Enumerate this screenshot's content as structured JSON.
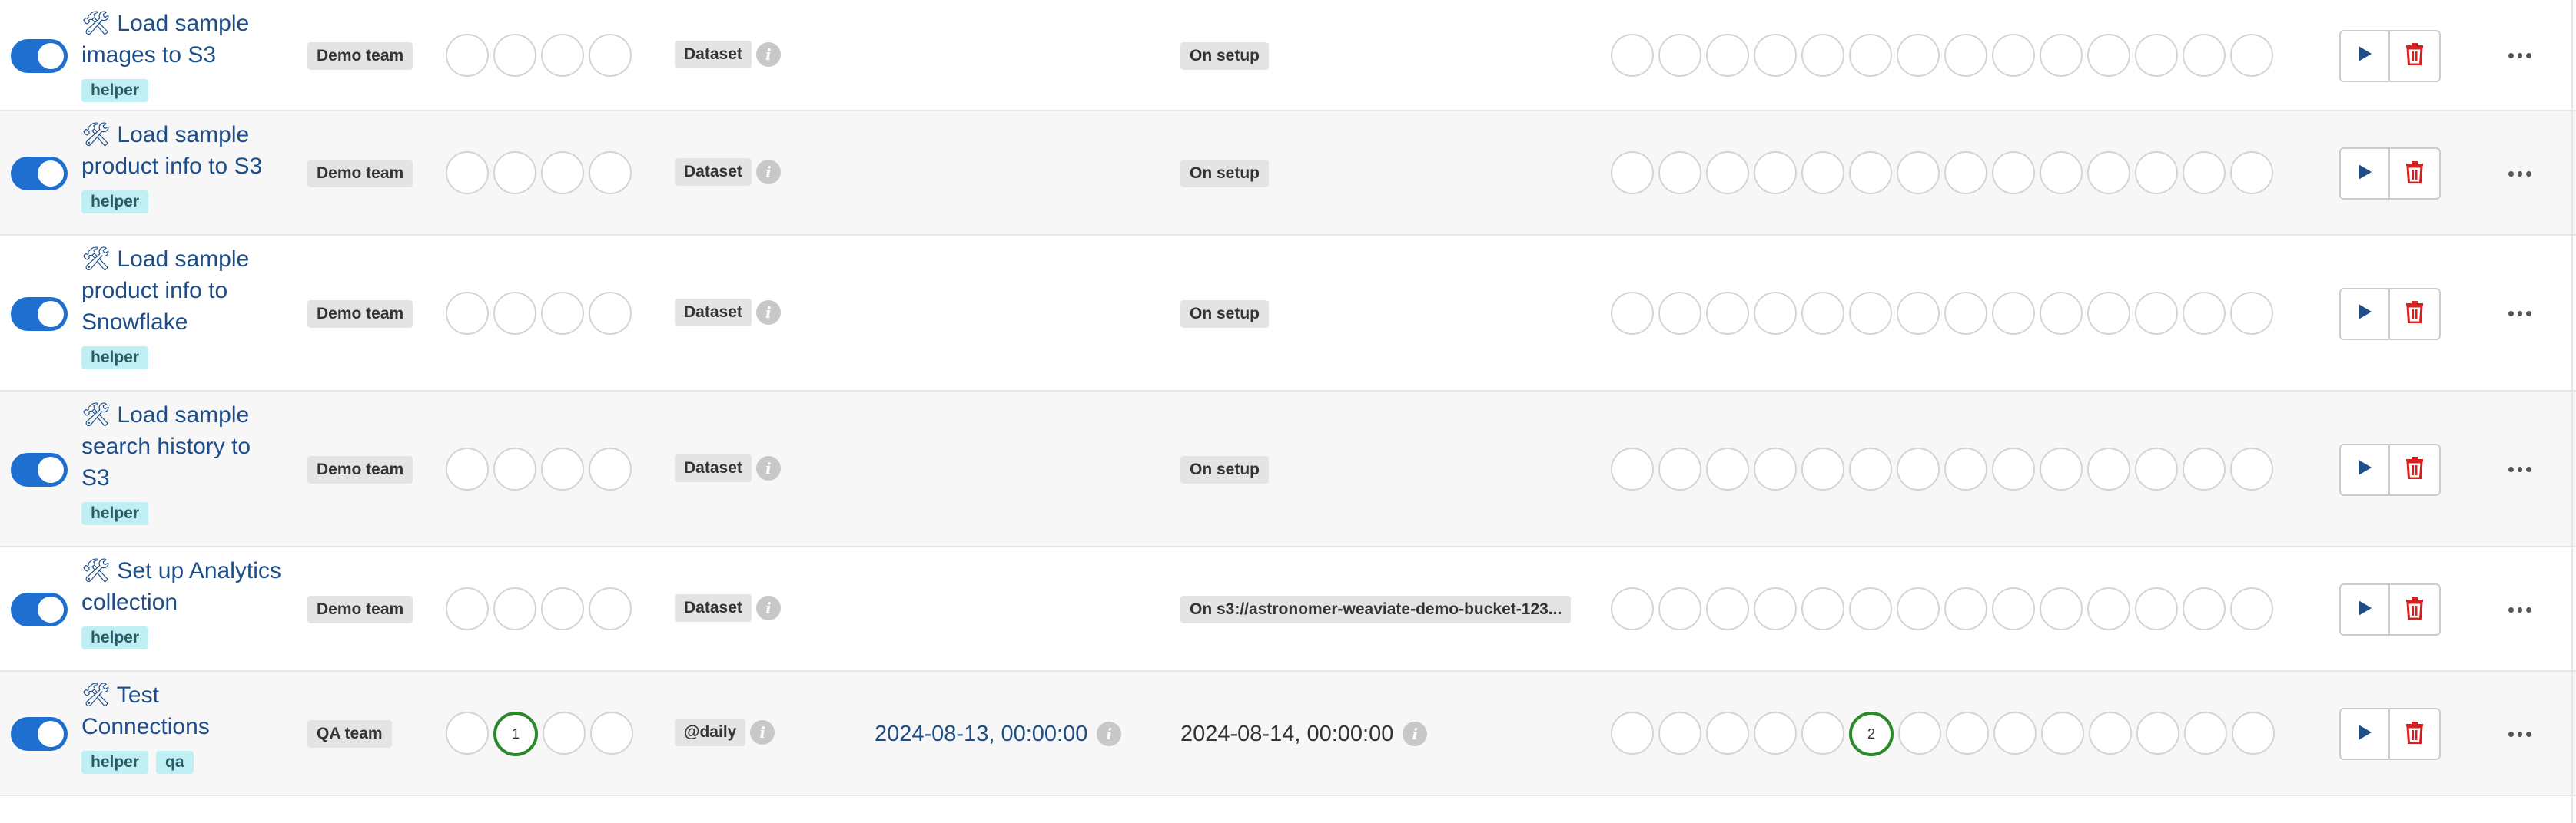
{
  "dags": [
    {
      "enabled": true,
      "icon": "hammer-wrench-icon",
      "name_lines": [
        "🛠 Load sample",
        "images to S3"
      ],
      "tags": [
        "helper"
      ],
      "owner": "Demo team",
      "runs": [
        "",
        "",
        "",
        ""
      ],
      "run_states": [
        "none",
        "none",
        "none",
        "none"
      ],
      "schedule": "Dataset",
      "last_run": "",
      "next_run_badge": "On setup",
      "next_run_text": "",
      "recent_tasks": [
        "",
        "",
        "",
        "",
        "",
        "",
        "",
        "",
        "",
        "",
        "",
        "",
        "",
        ""
      ],
      "recent_states": [
        "none",
        "none",
        "none",
        "none",
        "none",
        "none",
        "none",
        "none",
        "none",
        "none",
        "none",
        "none",
        "none",
        "none"
      ]
    },
    {
      "enabled": true,
      "icon": "hammer-wrench-icon",
      "name_lines": [
        "🛠 Load sample",
        "product info to S3"
      ],
      "tags": [
        "helper"
      ],
      "owner": "Demo team",
      "runs": [
        "",
        "",
        "",
        ""
      ],
      "run_states": [
        "none",
        "none",
        "none",
        "none"
      ],
      "schedule": "Dataset",
      "last_run": "",
      "next_run_badge": "On setup",
      "next_run_text": "",
      "recent_tasks": [
        "",
        "",
        "",
        "",
        "",
        "",
        "",
        "",
        "",
        "",
        "",
        "",
        "",
        ""
      ],
      "recent_states": [
        "none",
        "none",
        "none",
        "none",
        "none",
        "none",
        "none",
        "none",
        "none",
        "none",
        "none",
        "none",
        "none",
        "none"
      ]
    },
    {
      "enabled": true,
      "icon": "hammer-wrench-icon",
      "name_lines": [
        "🛠 Load sample",
        "product info to",
        "Snowflake"
      ],
      "tags": [
        "helper"
      ],
      "owner": "Demo team",
      "runs": [
        "",
        "",
        "",
        ""
      ],
      "run_states": [
        "none",
        "none",
        "none",
        "none"
      ],
      "schedule": "Dataset",
      "last_run": "",
      "next_run_badge": "On setup",
      "next_run_text": "",
      "recent_tasks": [
        "",
        "",
        "",
        "",
        "",
        "",
        "",
        "",
        "",
        "",
        "",
        "",
        "",
        ""
      ],
      "recent_states": [
        "none",
        "none",
        "none",
        "none",
        "none",
        "none",
        "none",
        "none",
        "none",
        "none",
        "none",
        "none",
        "none",
        "none"
      ]
    },
    {
      "enabled": true,
      "icon": "hammer-wrench-icon",
      "name_lines": [
        "🛠 Load sample",
        "search history to",
        "S3"
      ],
      "tags": [
        "helper"
      ],
      "owner": "Demo team",
      "runs": [
        "",
        "",
        "",
        ""
      ],
      "run_states": [
        "none",
        "none",
        "none",
        "none"
      ],
      "schedule": "Dataset",
      "last_run": "",
      "next_run_badge": "On setup",
      "next_run_text": "",
      "recent_tasks": [
        "",
        "",
        "",
        "",
        "",
        "",
        "",
        "",
        "",
        "",
        "",
        "",
        "",
        ""
      ],
      "recent_states": [
        "none",
        "none",
        "none",
        "none",
        "none",
        "none",
        "none",
        "none",
        "none",
        "none",
        "none",
        "none",
        "none",
        "none"
      ]
    },
    {
      "enabled": true,
      "icon": "hammer-wrench-icon",
      "name_lines": [
        "🛠 Set up Analytics",
        "collection"
      ],
      "tags": [
        "helper"
      ],
      "owner": "Demo team",
      "runs": [
        "",
        "",
        "",
        ""
      ],
      "run_states": [
        "none",
        "none",
        "none",
        "none"
      ],
      "schedule": "Dataset",
      "last_run": "",
      "next_run_badge": "On s3://astronomer-weaviate-demo-bucket-123...",
      "next_run_text": "",
      "recent_tasks": [
        "",
        "",
        "",
        "",
        "",
        "",
        "",
        "",
        "",
        "",
        "",
        "",
        "",
        ""
      ],
      "recent_states": [
        "none",
        "none",
        "none",
        "none",
        "none",
        "none",
        "none",
        "none",
        "none",
        "none",
        "none",
        "none",
        "none",
        "none"
      ]
    },
    {
      "enabled": true,
      "icon": "hammer-wrench-icon",
      "name_lines": [
        "🛠 Test",
        "Connections"
      ],
      "tags": [
        "helper",
        "qa"
      ],
      "owner": "QA team",
      "runs": [
        "",
        "1",
        "",
        ""
      ],
      "run_states": [
        "none",
        "success",
        "none",
        "none"
      ],
      "schedule": "@daily",
      "last_run": "2024-08-13, 00:00:00",
      "next_run_badge": "",
      "next_run_text": "2024-08-14, 00:00:00",
      "recent_tasks": [
        "",
        "",
        "",
        "",
        "",
        "2",
        "",
        "",
        "",
        "",
        "",
        "",
        "",
        ""
      ],
      "recent_states": [
        "none",
        "none",
        "none",
        "none",
        "none",
        "success",
        "none",
        "none",
        "none",
        "none",
        "none",
        "none",
        "none",
        "none"
      ]
    }
  ],
  "colors": {
    "toggle_on": "#1f6fd1",
    "link": "#1d4e89",
    "tag_bg": "#bfeff2",
    "badge_bg": "#e4e4e4",
    "success": "#2a8a2a",
    "play": "#1d4e89",
    "delete": "#d62020"
  },
  "actions": {
    "play_icon": "play-icon",
    "delete_icon": "trash-icon",
    "more_icon": "more-horizontal-icon"
  }
}
